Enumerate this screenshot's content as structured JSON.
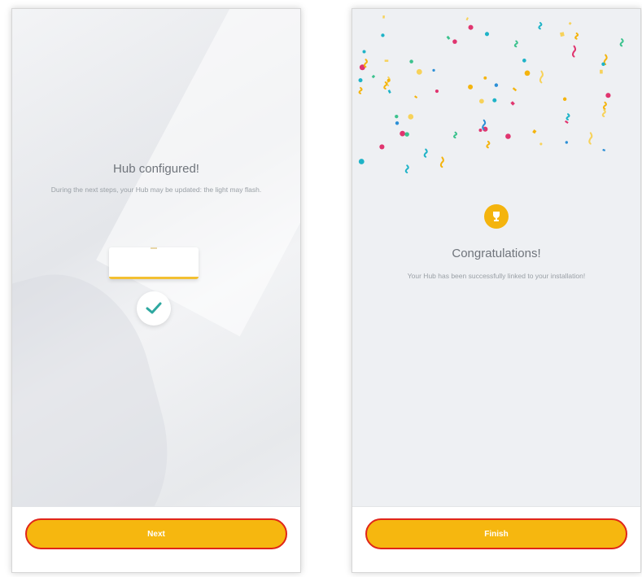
{
  "hub_configured_screen": {
    "title": "Hub configured!",
    "description": "During the next steps, your Hub may be updated: the light may flash.",
    "next_button": "Next"
  },
  "congratulations_screen": {
    "title": "Congratulations!",
    "description": "Your Hub has been successfully linked to your installation!",
    "finish_button": "Finish"
  },
  "colors": {
    "accent": "#f6b70f",
    "highlight_outline": "#e0251a",
    "check": "#2ea8a0",
    "confetti": [
      "#f4b40e",
      "#1eb3c7",
      "#e0356f",
      "#3bc28d",
      "#f7d25a",
      "#2b8fd6"
    ]
  },
  "icons": {
    "check": "checkmark-icon",
    "trophy": "trophy-icon"
  }
}
